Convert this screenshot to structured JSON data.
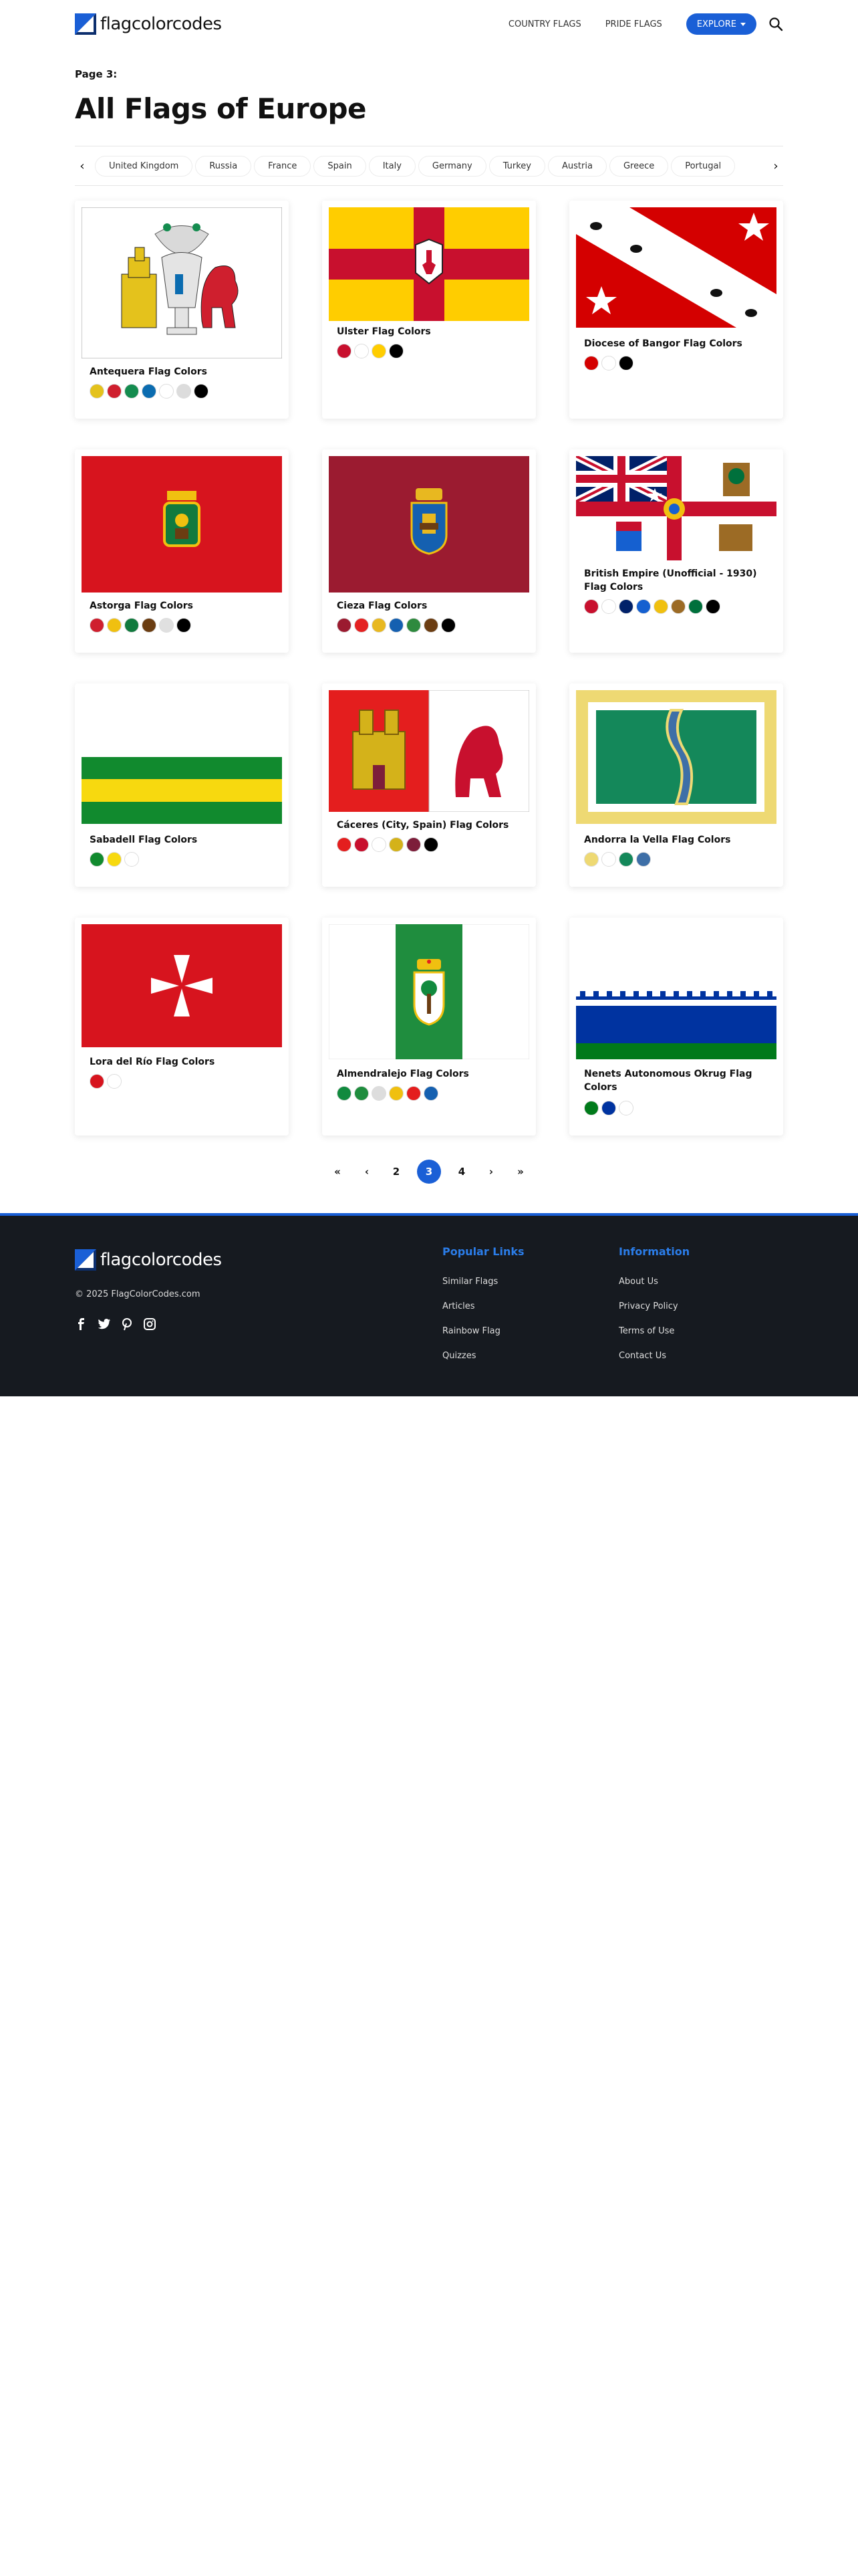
{
  "header": {
    "logo_text": "flagcolorcodes",
    "nav": [
      "COUNTRY FLAGS",
      "PRIDE FLAGS"
    ],
    "explore_label": "EXPLORE",
    "accent": "#1a5fd6"
  },
  "page_label": "Page 3:",
  "page_title": "All Flags of Europe",
  "categories": [
    "United Kingdom",
    "Russia",
    "France",
    "Spain",
    "Italy",
    "Germany",
    "Turkey",
    "Austria",
    "Greece",
    "Portugal"
  ],
  "cards": [
    {
      "name": "Antequera Flag Colors",
      "colors": [
        "#e4c21c",
        "#cf1f2e",
        "#148c4f",
        "#0b6cb0",
        "#ffffff",
        "#dcdcdc",
        "#000000"
      ]
    },
    {
      "name": "Ulster Flag Colors",
      "colors": [
        "#c8102e",
        "#ffffff",
        "#ffcd00",
        "#000000"
      ]
    },
    {
      "name": "Diocese of Bangor Flag Colors",
      "colors": [
        "#d40000",
        "#ffffff",
        "#000000"
      ]
    },
    {
      "name": "Astorga Flag Colors",
      "colors": [
        "#cf1f2e",
        "#f0c010",
        "#117a3e",
        "#6b3d12",
        "#e0e0e0",
        "#000000"
      ]
    },
    {
      "name": "Cieza Flag Colors",
      "colors": [
        "#9b1b30",
        "#e42222",
        "#e8b820",
        "#1560b0",
        "#2e8a3e",
        "#6b3d12",
        "#000000"
      ]
    },
    {
      "name": "British Empire (Unofficial - 1930) Flag Colors",
      "colors": [
        "#c8102e",
        "#ffffff",
        "#012169",
        "#1560d0",
        "#f0c010",
        "#9c6b25",
        "#00703c",
        "#000000"
      ]
    },
    {
      "name": "Sabadell Flag Colors",
      "colors": [
        "#118a2e",
        "#f7d90f",
        "#ffffff"
      ]
    },
    {
      "name": "Cáceres (City, Spain) Flag Colors",
      "colors": [
        "#e41e1e",
        "#c8102e",
        "#ffffff",
        "#d4b21a",
        "#7d1d3a",
        "#000000"
      ]
    },
    {
      "name": "Andorra la Vella Flag Colors",
      "colors": [
        "#eed973",
        "#ffffff",
        "#14885a",
        "#3e6fa7"
      ]
    },
    {
      "name": "Lora del Río Flag Colors",
      "colors": [
        "#d7141e",
        "#ffffff"
      ]
    },
    {
      "name": "Almendralejo Flag Colors",
      "colors": [
        "#118a3e",
        "#1f8d3e",
        "#dddddd",
        "#f0c010",
        "#e41e1e",
        "#1560b0"
      ]
    },
    {
      "name": "Nenets Autonomous Okrug Flag Colors",
      "colors": [
        "#007a1a",
        "#0033a0",
        "#ffffff"
      ]
    }
  ],
  "pagination": {
    "first": "«",
    "prev": "‹",
    "pages": [
      "2",
      "3",
      "4"
    ],
    "current": "3",
    "next": "›",
    "last": "»"
  },
  "footer": {
    "logo_text": "flagcolorcodes",
    "copyright": "© 2025 FlagColorCodes.com",
    "popular_title": "Popular Links",
    "popular_links": [
      "Similar Flags",
      "Articles",
      "Rainbow Flag",
      "Quizzes"
    ],
    "info_title": "Information",
    "info_links": [
      "About Us",
      "Privacy Policy",
      "Terms of Use",
      "Contact Us"
    ],
    "social_icons": [
      "facebook-icon",
      "twitter-icon",
      "pinterest-icon",
      "instagram-icon"
    ]
  }
}
